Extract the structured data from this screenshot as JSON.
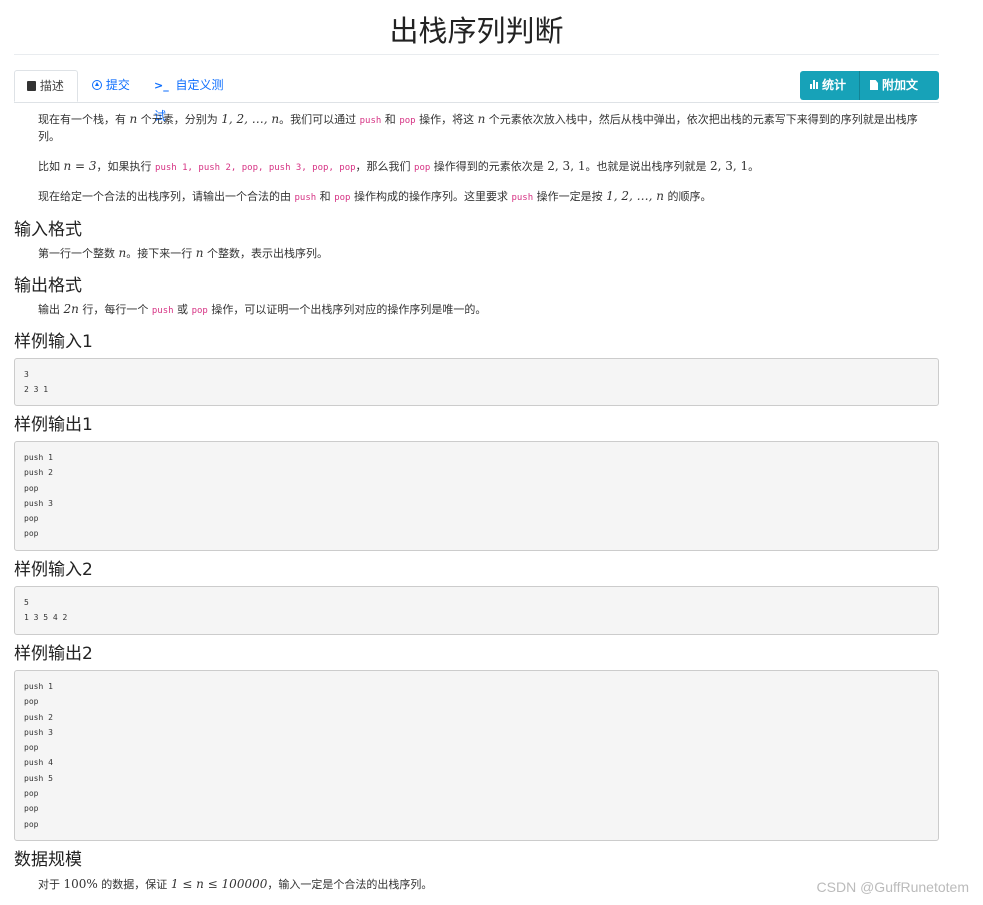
{
  "title": "出栈序列判断",
  "tabs": [
    {
      "label": "描述",
      "icon": "book-icon"
    },
    {
      "label": "提交",
      "icon": "upload-circle-icon"
    },
    {
      "label": "自定义测试",
      "icon": "terminal-icon"
    }
  ],
  "buttons": {
    "stats": "统计",
    "attach": "附加文件"
  },
  "desc": {
    "p1": {
      "a": "现在有一个栈，有 ",
      "n1": "n",
      "b": " 个元素，分别为 ",
      "seq": "1, 2, …, n",
      "c": "。我们可以通过 ",
      "push": "push",
      "d": " 和 ",
      "pop": "pop",
      "e": " 操作，将这 ",
      "n2": "n",
      "f": " 个元素依次放入栈中，然后从栈中弹出，依次把出栈的元素写下来得到的序列就是出栈序列。"
    },
    "p2": {
      "a": "比如 ",
      "eq": "n = 3",
      "b": "，如果执行 ",
      "ops": "push 1, push 2, pop, push 3, pop, pop",
      "c": "，那么我们 ",
      "pop": "pop",
      "d": " 操作得到的元素依次是 ",
      "s1": "2, 3, 1",
      "e": "。也就是说出栈序列就是 ",
      "s2": "2, 3, 1",
      "f": "。"
    },
    "p3": {
      "a": "现在给定一个合法的出栈序列，请输出一个合法的由 ",
      "push": "push",
      "b": " 和 ",
      "pop": "pop",
      "c": " 操作构成的操作序列。这里要求 ",
      "push2": "push",
      "d": " 操作一定是按 ",
      "seq": "1, 2, …, n",
      "e": " 的顺序。"
    }
  },
  "input_format": {
    "heading": "输入格式",
    "a": "第一行一个整数 ",
    "n1": "n",
    "b": "。接下来一行 ",
    "n2": "n",
    "c": " 个整数，表示出栈序列。"
  },
  "output_format": {
    "heading": "输出格式",
    "a": "输出 ",
    "two_n": "2n",
    "b": " 行，每行一个 ",
    "push": "push",
    "c": " 或 ",
    "pop": "pop",
    "d": " 操作，可以证明一个出栈序列对应的操作序列是唯一的。"
  },
  "samples": [
    {
      "heading": "样例输入1",
      "lines": [
        "3",
        "2 3 1"
      ]
    },
    {
      "heading": "样例输出1",
      "lines": [
        "push 1",
        "push 2",
        "pop",
        "push 3",
        "pop",
        "pop"
      ]
    },
    {
      "heading": "样例输入2",
      "lines": [
        "5",
        "1 3 5 4 2"
      ]
    },
    {
      "heading": "样例输出2",
      "lines": [
        "push 1",
        "pop",
        "push 2",
        "push 3",
        "pop",
        "push 4",
        "push 5",
        "pop",
        "pop",
        "pop"
      ]
    }
  ],
  "limits": {
    "heading": "数据规模",
    "a": "对于 ",
    "pct": "100%",
    "b": " 的数据，保证 ",
    "range": "1 ≤ n ≤ 100000",
    "c": "，输入一定是个合法的出栈序列。"
  },
  "watermark": "CSDN @GuffRunetotem",
  "colors": {
    "accent": "#17a2b8",
    "link": "#0d6efd",
    "code": "#d63384"
  }
}
